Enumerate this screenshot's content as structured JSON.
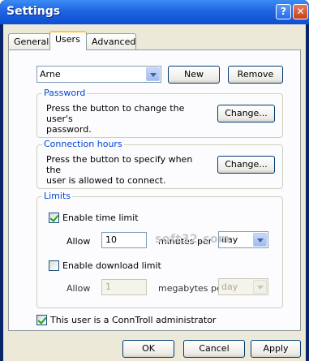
{
  "window": {
    "title": "Settings",
    "help_glyph": "?",
    "close_glyph": "✕"
  },
  "tabs": [
    {
      "label": "General"
    },
    {
      "label": "Users",
      "active": true
    },
    {
      "label": "Advanced"
    }
  ],
  "user_select": {
    "selected": "Arne"
  },
  "user_buttons": {
    "new_label": "New",
    "remove_label": "Remove"
  },
  "password": {
    "group_label": "Password",
    "description_line1": "Press the button to change the user's",
    "description_line2": "password.",
    "button_label": "Change..."
  },
  "connection_hours": {
    "group_label": "Connection hours",
    "description_line1": "Press the button to specify when the",
    "description_line2": "user is allowed to connect.",
    "button_label": "Change..."
  },
  "limits": {
    "group_label": "Limits",
    "time_limit": {
      "checkbox_label": "Enable time limit",
      "checked": true,
      "allow_label": "Allow",
      "value": "10",
      "unit_label": "minutes per",
      "period": "day"
    },
    "download_limit": {
      "checkbox_label": "Enable download limit",
      "checked": false,
      "allow_label": "Allow",
      "value": "1",
      "unit_label": "megabytes per",
      "period": "day"
    }
  },
  "admin": {
    "checkbox_label": "This user is a ConnTroll administrator",
    "checked": true
  },
  "watermark": "soft32.com",
  "dialog_buttons": {
    "ok_label": "OK",
    "cancel_label": "Cancel",
    "apply_label": "Apply"
  },
  "colors": {
    "titlebar": "#0c4fd2",
    "group_label": "#0046d5",
    "checkmark": "#21a121",
    "face": "#ece9d8"
  }
}
